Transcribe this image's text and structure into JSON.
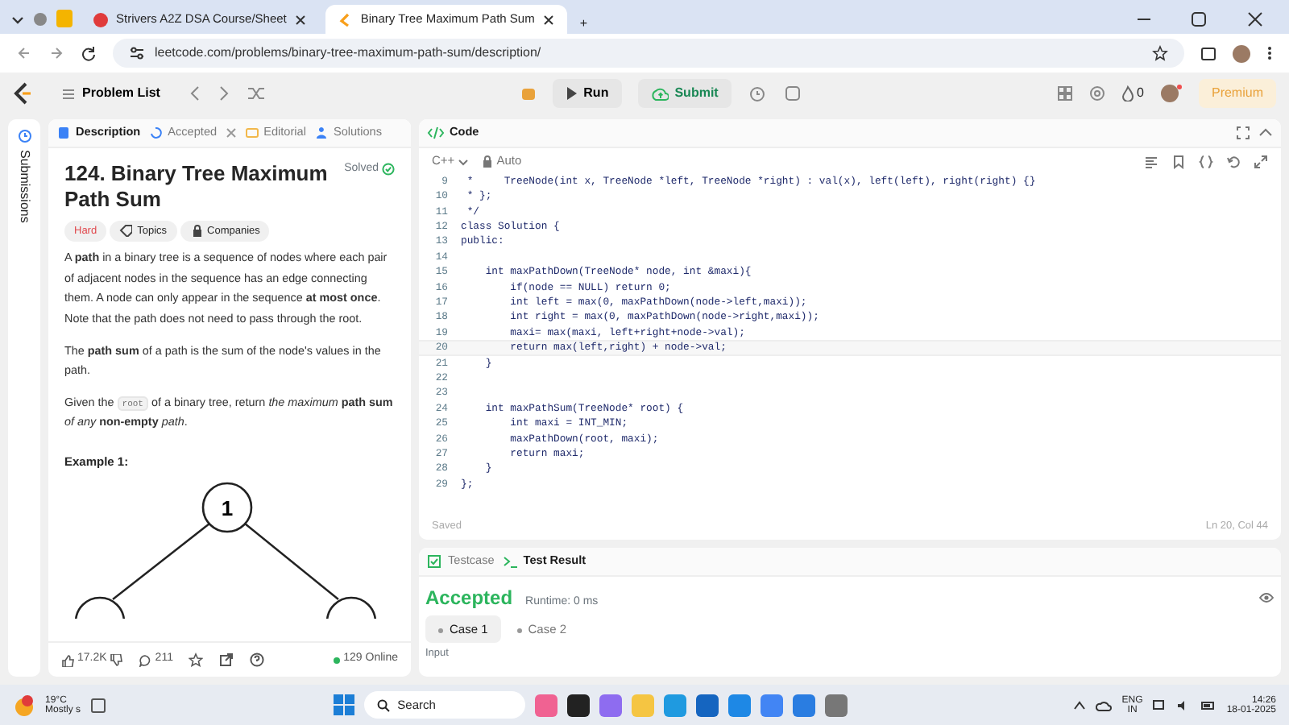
{
  "browser": {
    "tabs": [
      {
        "title": "Strivers A2Z DSA Course/Sheet",
        "selected": false
      },
      {
        "title": "Binary Tree Maximum Path Sum",
        "selected": true
      }
    ],
    "new_tab": "+",
    "url": "leetcode.com/problems/binary-tree-maximum-path-sum/description/"
  },
  "nav": {
    "problem_list": "Problem List",
    "run": "Run",
    "submit": "Submit",
    "streak": "0",
    "premium": "Premium"
  },
  "sidebar_tab": "Submissions",
  "description_tabs": [
    {
      "label": "Description",
      "selected": true
    },
    {
      "label": "Accepted",
      "selected": false
    },
    {
      "label": "Editorial",
      "selected": false
    },
    {
      "label": "Solutions",
      "selected": false
    }
  ],
  "problem": {
    "title": "124. Binary Tree Maximum Path Sum",
    "status": "Solved",
    "difficulty": "Hard",
    "tags": [
      "Topics",
      "Companies"
    ],
    "paragraphs": [
      {
        "text": "A **path** in a binary tree is a sequence of nodes where each pair of adjacent nodes in the sequence has an edge connecting them. A node can only appear in the sequence **at most once**. Note that the path does not need to pass through the root."
      },
      {
        "text": "The **path sum** of a path is the sum of the node's values in the path."
      },
      {
        "text": "of a binary tree, return *the maximum* **path sum** *of any* **non-empty** *path*.",
        "lead": "Given the",
        "code": "root"
      }
    ],
    "example_heading": "Example 1:",
    "diagram_root": "1"
  },
  "footer": {
    "likes": "17.2K",
    "comments": "211",
    "online": "129 Online"
  },
  "editor": {
    "title": "Code",
    "language": "C++",
    "mode": "Auto",
    "status": "Saved",
    "cursor": "Ln 20, Col 44",
    "lines": [
      {
        "n": "9",
        "code": " *     TreeNode(int x, TreeNode *left, TreeNode *right) : val(x), left(left), right(right) {}",
        "current": false
      },
      {
        "n": "10",
        "code": " * };",
        "current": false
      },
      {
        "n": "11",
        "code": " */",
        "current": false
      },
      {
        "n": "12",
        "code": "class Solution {",
        "current": false
      },
      {
        "n": "13",
        "code": "public:",
        "current": false
      },
      {
        "n": "14",
        "current": false
      },
      {
        "n": "15",
        "code": "    int maxPathDown(TreeNode* node, int &maxi){",
        "current": false
      },
      {
        "n": "16",
        "code": "        if(node == NULL) return 0;",
        "current": false
      },
      {
        "n": "17",
        "code": "        int left = max(0, maxPathDown(node->left,maxi));",
        "current": false
      },
      {
        "n": "18",
        "code": "        int right = max(0, maxPathDown(node->right,maxi));",
        "current": false
      },
      {
        "n": "19",
        "code": "        maxi= max(maxi, left+right+node->val);",
        "current": false
      },
      {
        "n": "20",
        "code": "        return max(left,right) + node->val;",
        "current": true
      },
      {
        "n": "21",
        "code": "    }",
        "current": false
      },
      {
        "n": "22",
        "current": false
      },
      {
        "n": "23",
        "current": false
      },
      {
        "n": "24",
        "code": "    int maxPathSum(TreeNode* root) {",
        "current": false
      },
      {
        "n": "25",
        "code": "        int maxi = INT_MIN;",
        "current": false
      },
      {
        "n": "26",
        "code": "        maxPathDown(root, maxi);",
        "current": false
      },
      {
        "n": "27",
        "code": "        return maxi;",
        "current": false
      },
      {
        "n": "28",
        "code": "    }",
        "current": false
      },
      {
        "n": "29",
        "code": "};",
        "current": false
      }
    ]
  },
  "results": {
    "tabs": [
      {
        "label": "Testcase",
        "selected": false
      },
      {
        "label": "Test Result",
        "selected": true
      }
    ],
    "verdict": "Accepted",
    "runtime": "Runtime: 0 ms",
    "cases": [
      {
        "label": "Case 1",
        "selected": true
      },
      {
        "label": "Case 2",
        "selected": false
      }
    ],
    "input_label": "Input"
  },
  "taskbar": {
    "temperature": "19°C",
    "weather": "Mostly s",
    "search": "Search",
    "language": "ENG",
    "region": "IN",
    "time": "14:26",
    "date": "18-01-2025"
  }
}
